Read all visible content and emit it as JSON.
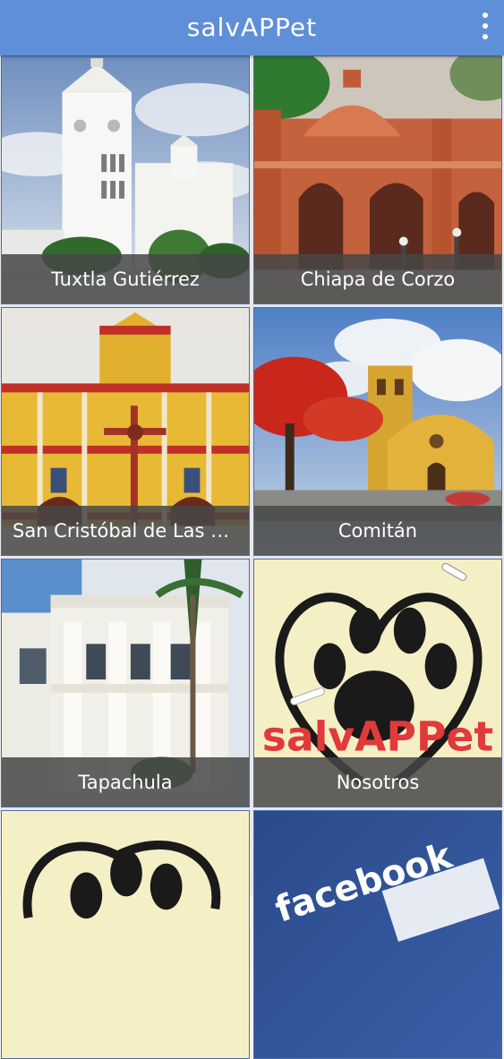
{
  "app": {
    "title": "salvAPPet"
  },
  "tiles": [
    {
      "label": "Tuxtla Gutiérrez",
      "image": "white cathedral bell tower"
    },
    {
      "label": "Chiapa de Corzo",
      "image": "brick colonial fountain"
    },
    {
      "label": "San Cristóbal de Las Casas",
      "image": "yellow and red cathedral facade"
    },
    {
      "label": "Comitán",
      "image": "yellow church with red flowering tree"
    },
    {
      "label": "Tapachula",
      "image": "white neoclassical building with palms"
    },
    {
      "label": "Nosotros",
      "image": "salvAPPet paw heart logo"
    },
    {
      "label": "",
      "image": "salvAPPet paw heart logo"
    },
    {
      "label": "",
      "image": "facebook logo"
    }
  ],
  "logo": {
    "text": "salvAPPet",
    "brand_red": "#e03a3a"
  },
  "facebook": {
    "text": "facebook"
  },
  "colors": {
    "appbar": "#5f8fd8",
    "caption_bg": "#464646",
    "tile_border": "#4a6fb2"
  }
}
